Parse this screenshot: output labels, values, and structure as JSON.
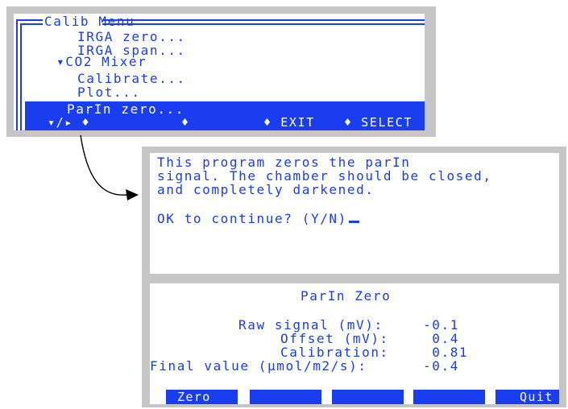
{
  "colors": {
    "accent": "#1a3df0",
    "panel": "#c6c6c6",
    "screen": "#ffffff"
  },
  "menu": {
    "title": "Calib Menu",
    "items": [
      "IRGA zero...",
      "IRGA span...",
      "▾CO2 Mixer",
      "Calibrate...",
      "Plot..."
    ],
    "selected": "ParIn zero...",
    "fkeys": [
      "▾/▸ ♦",
      "♦",
      "♦ EXIT",
      "♦ SELECT"
    ]
  },
  "prompt": {
    "lines": [
      "This program zeros the parIn",
      "signal. The chamber should be closed,",
      "and completely darkened."
    ],
    "question": "OK to continue? (Y/N)"
  },
  "zero": {
    "title": "ParIn Zero",
    "rows": [
      {
        "label": "Raw signal (mV):",
        "value": "-0.1"
      },
      {
        "label": "Offset (mV):",
        "value": " 0.4"
      },
      {
        "label": "Calibration:",
        "value": " 0.81"
      },
      {
        "label": "Final value (µmol/m2/s):",
        "value": "-0.4"
      }
    ],
    "fkeys": [
      "Zero",
      "",
      "",
      "",
      "Quit"
    ]
  }
}
